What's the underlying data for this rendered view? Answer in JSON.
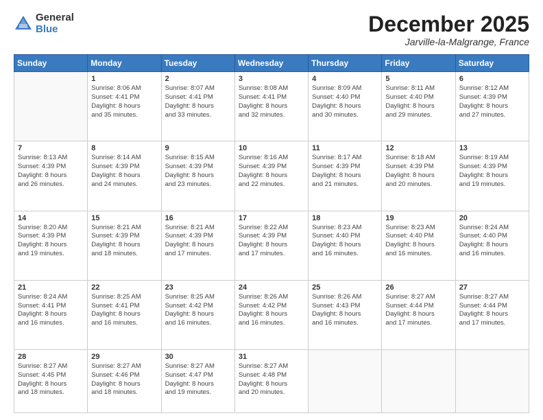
{
  "header": {
    "logo_general": "General",
    "logo_blue": "Blue",
    "month_title": "December 2025",
    "location": "Jarville-la-Malgrange, France"
  },
  "weekdays": [
    "Sunday",
    "Monday",
    "Tuesday",
    "Wednesday",
    "Thursday",
    "Friday",
    "Saturday"
  ],
  "weeks": [
    [
      {
        "day": "",
        "info": ""
      },
      {
        "day": "1",
        "info": "Sunrise: 8:06 AM\nSunset: 4:41 PM\nDaylight: 8 hours\nand 35 minutes."
      },
      {
        "day": "2",
        "info": "Sunrise: 8:07 AM\nSunset: 4:41 PM\nDaylight: 8 hours\nand 33 minutes."
      },
      {
        "day": "3",
        "info": "Sunrise: 8:08 AM\nSunset: 4:41 PM\nDaylight: 8 hours\nand 32 minutes."
      },
      {
        "day": "4",
        "info": "Sunrise: 8:09 AM\nSunset: 4:40 PM\nDaylight: 8 hours\nand 30 minutes."
      },
      {
        "day": "5",
        "info": "Sunrise: 8:11 AM\nSunset: 4:40 PM\nDaylight: 8 hours\nand 29 minutes."
      },
      {
        "day": "6",
        "info": "Sunrise: 8:12 AM\nSunset: 4:39 PM\nDaylight: 8 hours\nand 27 minutes."
      }
    ],
    [
      {
        "day": "7",
        "info": "Sunrise: 8:13 AM\nSunset: 4:39 PM\nDaylight: 8 hours\nand 26 minutes."
      },
      {
        "day": "8",
        "info": "Sunrise: 8:14 AM\nSunset: 4:39 PM\nDaylight: 8 hours\nand 24 minutes."
      },
      {
        "day": "9",
        "info": "Sunrise: 8:15 AM\nSunset: 4:39 PM\nDaylight: 8 hours\nand 23 minutes."
      },
      {
        "day": "10",
        "info": "Sunrise: 8:16 AM\nSunset: 4:39 PM\nDaylight: 8 hours\nand 22 minutes."
      },
      {
        "day": "11",
        "info": "Sunrise: 8:17 AM\nSunset: 4:39 PM\nDaylight: 8 hours\nand 21 minutes."
      },
      {
        "day": "12",
        "info": "Sunrise: 8:18 AM\nSunset: 4:39 PM\nDaylight: 8 hours\nand 20 minutes."
      },
      {
        "day": "13",
        "info": "Sunrise: 8:19 AM\nSunset: 4:39 PM\nDaylight: 8 hours\nand 19 minutes."
      }
    ],
    [
      {
        "day": "14",
        "info": "Sunrise: 8:20 AM\nSunset: 4:39 PM\nDaylight: 8 hours\nand 19 minutes."
      },
      {
        "day": "15",
        "info": "Sunrise: 8:21 AM\nSunset: 4:39 PM\nDaylight: 8 hours\nand 18 minutes."
      },
      {
        "day": "16",
        "info": "Sunrise: 8:21 AM\nSunset: 4:39 PM\nDaylight: 8 hours\nand 17 minutes."
      },
      {
        "day": "17",
        "info": "Sunrise: 8:22 AM\nSunset: 4:39 PM\nDaylight: 8 hours\nand 17 minutes."
      },
      {
        "day": "18",
        "info": "Sunrise: 8:23 AM\nSunset: 4:40 PM\nDaylight: 8 hours\nand 16 minutes."
      },
      {
        "day": "19",
        "info": "Sunrise: 8:23 AM\nSunset: 4:40 PM\nDaylight: 8 hours\nand 16 minutes."
      },
      {
        "day": "20",
        "info": "Sunrise: 8:24 AM\nSunset: 4:40 PM\nDaylight: 8 hours\nand 16 minutes."
      }
    ],
    [
      {
        "day": "21",
        "info": "Sunrise: 8:24 AM\nSunset: 4:41 PM\nDaylight: 8 hours\nand 16 minutes."
      },
      {
        "day": "22",
        "info": "Sunrise: 8:25 AM\nSunset: 4:41 PM\nDaylight: 8 hours\nand 16 minutes."
      },
      {
        "day": "23",
        "info": "Sunrise: 8:25 AM\nSunset: 4:42 PM\nDaylight: 8 hours\nand 16 minutes."
      },
      {
        "day": "24",
        "info": "Sunrise: 8:26 AM\nSunset: 4:42 PM\nDaylight: 8 hours\nand 16 minutes."
      },
      {
        "day": "25",
        "info": "Sunrise: 8:26 AM\nSunset: 4:43 PM\nDaylight: 8 hours\nand 16 minutes."
      },
      {
        "day": "26",
        "info": "Sunrise: 8:27 AM\nSunset: 4:44 PM\nDaylight: 8 hours\nand 17 minutes."
      },
      {
        "day": "27",
        "info": "Sunrise: 8:27 AM\nSunset: 4:44 PM\nDaylight: 8 hours\nand 17 minutes."
      }
    ],
    [
      {
        "day": "28",
        "info": "Sunrise: 8:27 AM\nSunset: 4:45 PM\nDaylight: 8 hours\nand 18 minutes."
      },
      {
        "day": "29",
        "info": "Sunrise: 8:27 AM\nSunset: 4:46 PM\nDaylight: 8 hours\nand 18 minutes."
      },
      {
        "day": "30",
        "info": "Sunrise: 8:27 AM\nSunset: 4:47 PM\nDaylight: 8 hours\nand 19 minutes."
      },
      {
        "day": "31",
        "info": "Sunrise: 8:27 AM\nSunset: 4:48 PM\nDaylight: 8 hours\nand 20 minutes."
      },
      {
        "day": "",
        "info": ""
      },
      {
        "day": "",
        "info": ""
      },
      {
        "day": "",
        "info": ""
      }
    ]
  ]
}
